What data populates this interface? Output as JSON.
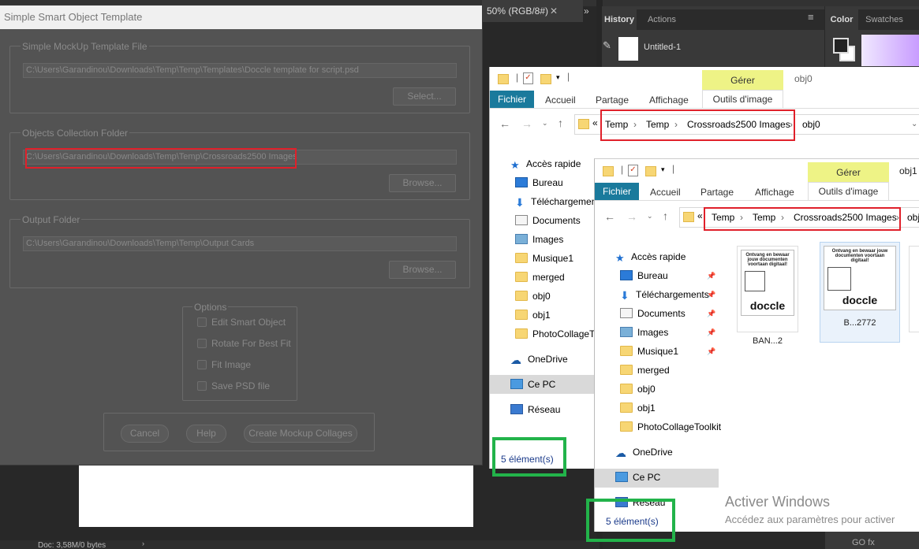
{
  "photoshop": {
    "document_tab": "50% (RGB/8#)",
    "document_close": "✕",
    "collapse_icon": "»",
    "history_tab": "History",
    "actions_tab": "Actions",
    "history_state": "Untitled-1",
    "color_tab": "Color",
    "swatches_tab": "Swatches",
    "status_text": "Doc: 3,58M/0 bytes",
    "bottom_icons": "GO fx"
  },
  "dialog": {
    "title": "Simple Smart Object Template",
    "template_group": "Simple MockUp Template File",
    "template_path": "C:\\Users\\Garandinou\\Downloads\\Temp\\Temp\\Templates\\Doccle template for script.psd",
    "select_button": "Select...",
    "objects_group": "Objects Collection Folder",
    "objects_path": "C:\\Users\\Garandinou\\Downloads\\Temp\\Temp\\Crossroads2500 Images",
    "objects_browse": "Browse...",
    "output_group": "Output Folder",
    "output_path": "C:\\Users\\Garandinou\\Downloads\\Temp\\Temp\\Output Cards",
    "output_browse": "Browse...",
    "options_group": "Options",
    "options": [
      "Edit Smart Object",
      "Rotate For Best Fit",
      "Fit Image",
      "Save PSD file"
    ],
    "cancel_button": "Cancel",
    "help_button": "Help",
    "create_button": "Create Mockup Collages"
  },
  "explorer_back": {
    "window_title": "obj0",
    "manage_tab": "Gérer",
    "file_tab": "Fichier",
    "ribbon_tabs": [
      "Accueil",
      "Partage",
      "Affichage"
    ],
    "picture_tools": "Outils d'image",
    "address_prefix": "«",
    "breadcrumb": [
      "Temp",
      "Temp",
      "Crossroads2500 Images",
      "obj0"
    ],
    "nav": [
      {
        "label": "Accès rapide",
        "icon": "star-icon"
      },
      {
        "label": "Bureau",
        "icon": "desktop-icon"
      },
      {
        "label": "Téléchargements",
        "icon": "download-icon"
      },
      {
        "label": "Documents",
        "icon": "document-icon"
      },
      {
        "label": "Images",
        "icon": "picture-icon"
      },
      {
        "label": "Musique1",
        "icon": "folder-icon"
      },
      {
        "label": "merged",
        "icon": "folder-icon"
      },
      {
        "label": "obj0",
        "icon": "folder-icon"
      },
      {
        "label": "obj1",
        "icon": "folder-icon"
      },
      {
        "label": "PhotoCollageToolkit",
        "icon": "folder-icon"
      },
      {
        "label": "OneDrive",
        "icon": "cloud-icon"
      },
      {
        "label": "Ce PC",
        "icon": "pc-icon"
      },
      {
        "label": "Réseau",
        "icon": "network-icon"
      }
    ],
    "status": "5 élément(s)"
  },
  "explorer_front": {
    "window_title": "obj1",
    "manage_tab": "Gérer",
    "file_tab": "Fichier",
    "ribbon_tabs": [
      "Accueil",
      "Partage",
      "Affichage"
    ],
    "picture_tools": "Outils d'image",
    "address_prefix": "«",
    "breadcrumb": [
      "Temp",
      "Temp",
      "Crossroads2500 Images",
      "obj"
    ],
    "nav": [
      {
        "label": "Accès rapide",
        "icon": "star-icon"
      },
      {
        "label": "Bureau",
        "icon": "desktop-icon"
      },
      {
        "label": "Téléchargements",
        "icon": "download-icon"
      },
      {
        "label": "Documents",
        "icon": "document-icon"
      },
      {
        "label": "Images",
        "icon": "picture-icon"
      },
      {
        "label": "Musique1",
        "icon": "folder-icon"
      },
      {
        "label": "merged",
        "icon": "folder-icon"
      },
      {
        "label": "obj0",
        "icon": "folder-icon"
      },
      {
        "label": "obj1",
        "icon": "folder-icon"
      },
      {
        "label": "PhotoCollageToolkit",
        "icon": "folder-icon"
      },
      {
        "label": "OneDrive",
        "icon": "cloud-icon"
      },
      {
        "label": "Ce PC",
        "icon": "pc-icon"
      },
      {
        "label": "Réseau",
        "icon": "network-icon"
      }
    ],
    "thumbnails": [
      {
        "heading": "Ontvang en bewaar jouw documenten voortaan digitaal!",
        "logo": "doccle",
        "caption": "BAN...2"
      },
      {
        "heading": "Ontvang en bewaar jouw documenten voortaan digitaal!",
        "logo": "doccle",
        "caption": "B...2772"
      }
    ],
    "status": "5 élément(s)"
  },
  "watermark": {
    "line1": "Activer Windows",
    "line2": "Accédez aux paramètres pour activer"
  },
  "colors": {
    "highlight_red": "#e0202a",
    "highlight_green": "#22b34a",
    "file_tab_blue": "#1a7a9c",
    "manage_yellow": "#eef386"
  }
}
